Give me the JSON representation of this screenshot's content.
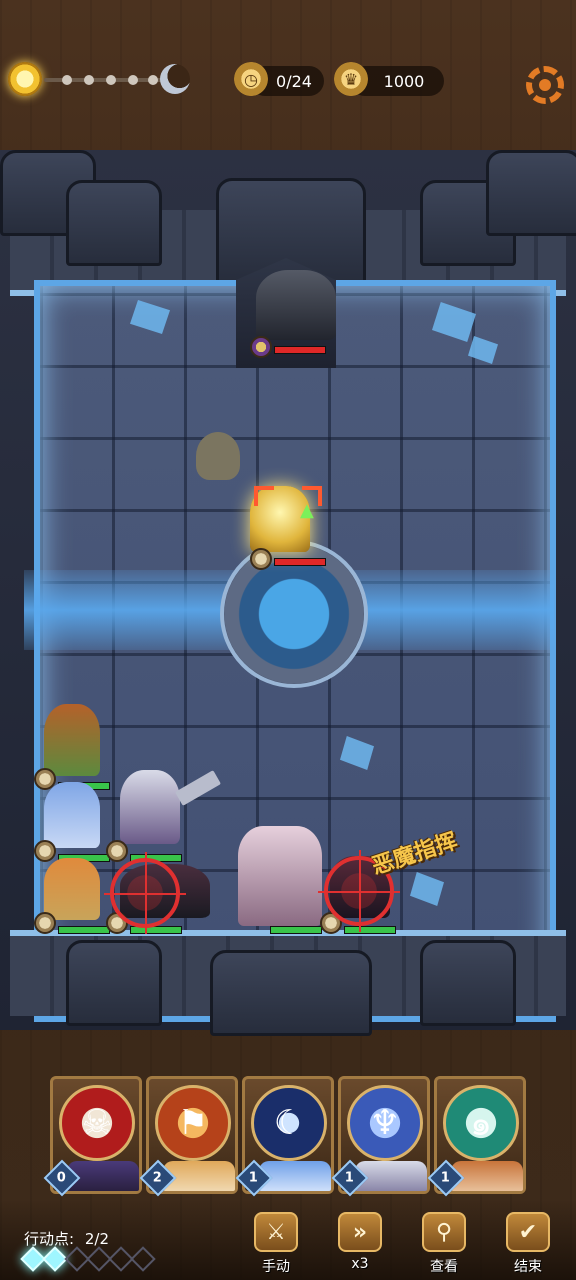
{
  "top_bar": {
    "turn_counter": "0/24",
    "gold": "1000",
    "day_icon": "sun-icon",
    "night_icon": "moon-icon",
    "settings_icon": "gear-icon"
  },
  "board": {
    "enemy_ability_label": "恶魔指挥"
  },
  "skill_cards": [
    {
      "icon": "skull-icon",
      "cost": "0",
      "color": "#b01c1c"
    },
    {
      "icon": "flag-icon",
      "cost": "2",
      "color": "#b5421a"
    },
    {
      "icon": "crescent-moon-icon",
      "cost": "1",
      "color": "#1a2e6a"
    },
    {
      "icon": "mermaid-icon",
      "cost": "1",
      "color": "#3a5ab8"
    },
    {
      "icon": "wind-swirl-icon",
      "cost": "1",
      "color": "#1f8a76"
    }
  ],
  "action_points": {
    "label": "行动点:",
    "value": "2/2"
  },
  "controls": {
    "manual": "手动",
    "speed": "x3",
    "view": "查看",
    "end": "结束"
  }
}
